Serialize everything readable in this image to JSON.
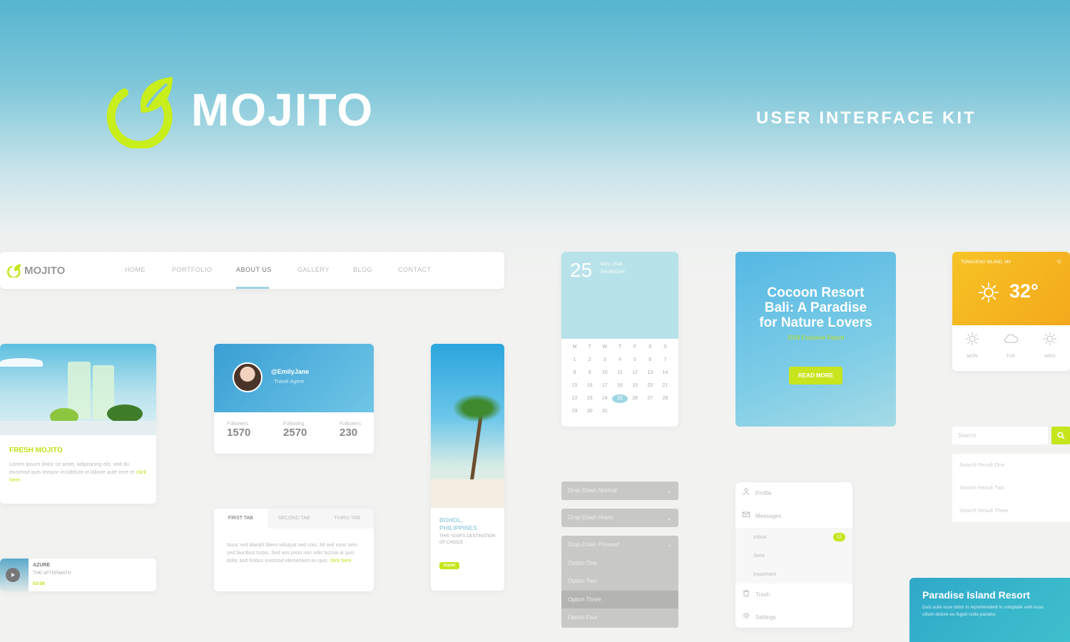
{
  "hero": {
    "brand": "MOJITO",
    "tagline": "USER INTERFACE KIT"
  },
  "navbar": {
    "logo": "MOJITO",
    "links": [
      "HOME",
      "PORTFOLIO",
      "ABOUT US",
      "GALLERY",
      "BLOG",
      "CONTACT"
    ],
    "active": "ABOUT US"
  },
  "product_card": {
    "title": "FRESH MOJITO",
    "text": "Lorem ipsum dolor sit amet, adipisicing elit, sed do eiusmod quis tempor incididunt ut labore aute ince et",
    "link": "click here."
  },
  "player": {
    "title": "AZURE",
    "artist": "THE AFTERMATH",
    "time": "03:08"
  },
  "profile": {
    "handle": "@EmilyJane",
    "role": "Travel Agent",
    "stats": [
      {
        "label": "Followers",
        "value": "1570"
      },
      {
        "label": "Following",
        "value": "2570"
      },
      {
        "label": "Followers",
        "value": "230"
      }
    ]
  },
  "tabs": {
    "items": [
      "FIRST TAB",
      "SECOND TAB",
      "THIRD TAB"
    ],
    "body": "Nunc sed blandit libero volutpat sed cras. Mi sed nunc sem sed faucibus turpis. Sed ans proin non odio lacinia at quis dolor and finibus euismod elementum eu quis.",
    "link": "click here."
  },
  "beach_card": {
    "title": "BOHOL, PHILIPPINES",
    "subtitle": "THIS YEAR'S DESTINATION OF CHOICE",
    "button": "travel"
  },
  "calendar": {
    "day": "25",
    "month_year": "NOV, 2018",
    "weekday": "THURSDAY",
    "weekday_headers": [
      "M",
      "T",
      "W",
      "T",
      "F",
      "S",
      "S"
    ],
    "days": [
      "1",
      "2",
      "3",
      "4",
      "5",
      "6",
      "7",
      "8",
      "9",
      "10",
      "11",
      "12",
      "13",
      "14",
      "15",
      "16",
      "17",
      "18",
      "19",
      "20",
      "21",
      "22",
      "23",
      "24",
      "25",
      "26",
      "27",
      "28",
      "29",
      "30",
      "31"
    ],
    "selected": "25"
  },
  "dropdowns": {
    "normal": "Drop-Down Normal",
    "hover": "Drop-Down Hover",
    "pressed": "Drop-Down Pressed",
    "options": [
      "Option One",
      "Option Two",
      "Option Three",
      "Option Four"
    ],
    "highlighted": "Option Three"
  },
  "resort": {
    "title_lines": [
      "Cocoon Resort",
      "Bali: A Paradise",
      "for Nature Lovers"
    ],
    "subtitle": "2018 Exclusive Report",
    "button": "READ MORE"
  },
  "menu": {
    "profile": "Profile",
    "messages": "Messages",
    "inbox": "Inbox",
    "inbox_count": "12",
    "sent": "Sent",
    "important": "Important",
    "trash": "Trash",
    "settings": "Settings"
  },
  "weather": {
    "location": "TONGUENG ISLAND, MV",
    "unit": "°C",
    "temp": "32°",
    "days": [
      "MON",
      "TUE",
      "WED"
    ]
  },
  "search": {
    "placeholder": "Search",
    "results": [
      "Search Result One",
      "Search Result Two",
      "Search Result Three"
    ]
  },
  "paradise": {
    "title": "Paradise Island Resort",
    "text": "Duis aute irure dolor in reprehenderit in voluptate velit esse cillum dolore eu fugiat nulla pariatur."
  },
  "colors": {
    "accent_green": "#c6e51d",
    "sky_blue": "#56b5d0",
    "weather_orange": "#f6c325"
  }
}
